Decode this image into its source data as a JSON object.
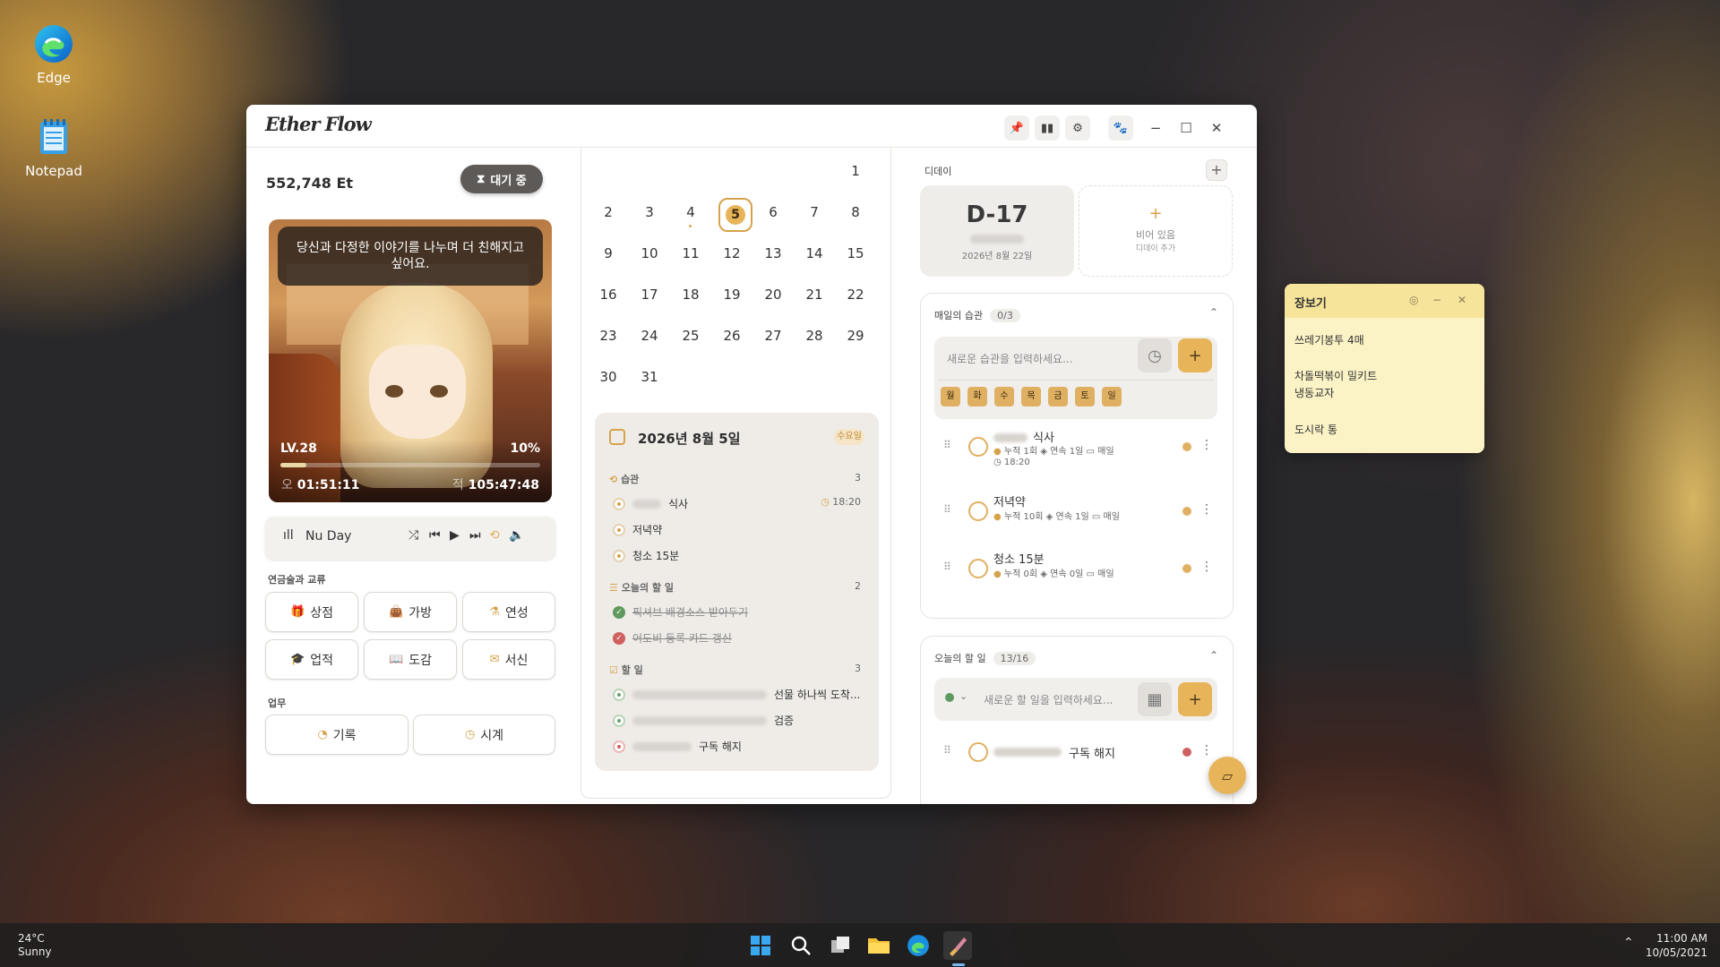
{
  "desktop": {
    "icons": [
      {
        "label": "Edge"
      },
      {
        "label": "Notepad"
      }
    ]
  },
  "window": {
    "title": "Ether Flow",
    "toolbar_icons": [
      "pin-icon",
      "book-icon",
      "gear-icon",
      "paw-icon"
    ]
  },
  "left": {
    "balance": "552,748 Et",
    "status_label": "대기 중",
    "speech": "당신과 다정한 이야기를 나누며 더 친해지고 싶어요.",
    "level": "LV.28",
    "level_progress_pct": "10%",
    "progress": 0.1,
    "time_left": "01:51:11",
    "time_right": "105:47:48",
    "time_left_prefix": "오",
    "time_right_prefix": "적",
    "player": {
      "track": "Nu Day"
    },
    "section_growth": "연금술과 교류",
    "buttons": [
      {
        "label": "상점",
        "icon": "gift-icon"
      },
      {
        "label": "가방",
        "icon": "bag-icon"
      },
      {
        "label": "연성",
        "icon": "flask-icon"
      },
      {
        "label": "업적",
        "icon": "trophy-icon"
      },
      {
        "label": "도감",
        "icon": "book-icon"
      },
      {
        "label": "서신",
        "icon": "mail-icon"
      }
    ],
    "section_work": "업무",
    "work_buttons": [
      {
        "label": "기록",
        "icon": "chart-icon"
      },
      {
        "label": "시계",
        "icon": "clock-icon"
      }
    ]
  },
  "calendar": {
    "weeks": [
      [
        "",
        "",
        "",
        "",
        "",
        "",
        "1"
      ],
      [
        "2",
        "3",
        "4",
        "5",
        "6",
        "7",
        "8"
      ],
      [
        "9",
        "10",
        "11",
        "12",
        "13",
        "14",
        "15"
      ],
      [
        "16",
        "17",
        "18",
        "19",
        "20",
        "21",
        "22"
      ],
      [
        "23",
        "24",
        "25",
        "26",
        "27",
        "28",
        "29"
      ],
      [
        "30",
        "31",
        "",
        "",
        "",
        "",
        ""
      ]
    ],
    "selected": "5",
    "agenda": {
      "date": "2026년 8월 5일",
      "weekday": "수요일",
      "habits_header": "습관",
      "habits_count": "3",
      "habits": [
        {
          "name": "식사",
          "time": "18:20"
        },
        {
          "name": "저녁약"
        },
        {
          "name": "청소 15분"
        }
      ],
      "todos_header": "오늘의 할 일",
      "todos_count": "2",
      "todos": [
        {
          "name": "픽셔브 배경소스 받아두기"
        },
        {
          "name": "어도비 등록 카드 갱신"
        }
      ],
      "tasks_header": "할 일",
      "tasks_count": "3",
      "tasks": [
        {
          "name": "선물 하나씩 도착..."
        },
        {
          "name": "검증"
        },
        {
          "name": "구독 해지"
        }
      ]
    }
  },
  "right": {
    "dday_title": "디데이",
    "dday": {
      "label": "D-17",
      "date": "2026년 8월 22일"
    },
    "empty_slot": {
      "title": "비어 있음",
      "sub": "디데이 추가"
    },
    "habits_card": {
      "title": "매일의 습관",
      "badge": "0/3",
      "placeholder": "새로운 습관을 입력하세요...",
      "weekdays": [
        "월",
        "화",
        "수",
        "목",
        "금",
        "토",
        "일"
      ],
      "items": [
        {
          "name": "식사",
          "meta1": "누적 1회",
          "meta2": "연속 1일",
          "meta3": "매일",
          "time": "18:20"
        },
        {
          "name": "저녁약",
          "meta1": "누적 10회",
          "meta2": "연속 1일",
          "meta3": "매일"
        },
        {
          "name": "청소 15분",
          "meta1": "누적 0회",
          "meta2": "연속 0일",
          "meta3": "매일"
        }
      ]
    },
    "todo_card": {
      "title": "오늘의 할 일",
      "badge": "13/16",
      "placeholder": "새로운 할 일을 입력하세요...",
      "items": [
        {
          "name": "구독 해지"
        }
      ]
    }
  },
  "note": {
    "title": "장보기",
    "lines": [
      "쓰레기봉투 4매",
      "차돌떡볶이 밀키트",
      "냉동교자",
      "도시락 통"
    ]
  },
  "taskbar": {
    "temp": "24°C",
    "weather": "Sunny",
    "time": "11:00 AM",
    "date": "10/05/2021"
  },
  "colors": {
    "accent": "#e8b45a",
    "accent_dark": "#d7a24c",
    "note_bg": "#fbf3c6"
  }
}
